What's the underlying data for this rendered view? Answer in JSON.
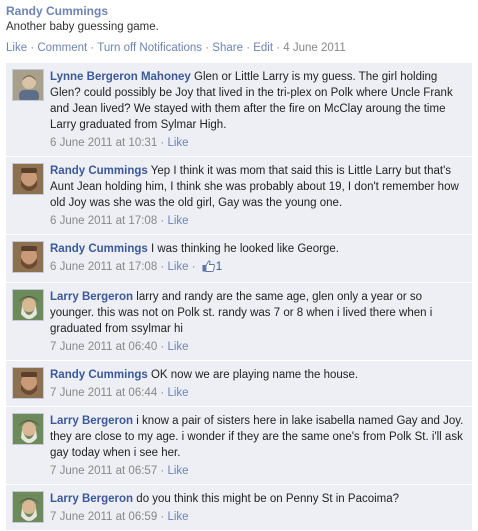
{
  "post": {
    "author": "Randy Cummings",
    "text": "Another baby guessing game.",
    "actions": [
      "Like",
      "Comment",
      "Turn off Notifications",
      "Share",
      "Edit"
    ],
    "date": "4 June 2011"
  },
  "comments": [
    {
      "author": "Lynne Bergeron Mahoney",
      "text": "Glen or Little Larry is my guess. The girl holding Glen? could possibly be Joy that lived in the tri-plex on Polk where Uncle Frank and Jean lived? We stayed with them after the fire on McClay aroung the time Larry graduated from Sylmar High.",
      "timestamp": "6 June 2011 at 10:31",
      "like": "Like"
    },
    {
      "author": "Randy Cummings",
      "text": "Yep I think it was mom that said this is Little Larry but that's Aunt Jean holding him, I think she was probably about 19, I don't remember how old Joy was she was the old girl, Gay was the young one.",
      "timestamp": "6 June 2011 at 17:08",
      "like": "Like"
    },
    {
      "author": "Randy Cummings",
      "text": "I was thinking he looked like George.",
      "timestamp": "6 June 2011 at 17:08",
      "like": "Like",
      "likes": "1"
    },
    {
      "author": "Larry Bergeron",
      "text": "larry and randy are the same age, glen only a year or so younger. this was not on Polk st. randy was 7 or 8 when i lived there when i graduated from ssylmar hi",
      "timestamp": "7 June 2011 at 06:40",
      "like": "Like"
    },
    {
      "author": "Randy Cummings",
      "text": "OK now we are playing name the house.",
      "timestamp": "7 June 2011 at 06:44",
      "like": "Like"
    },
    {
      "author": "Larry Bergeron",
      "text": "i know a pair of sisters here in lake isabella named Gay and Joy. they are close to my age. i wonder if they are the same one's from Polk St. i'll ask gay today when i see her.",
      "timestamp": "7 June 2011 at 06:57",
      "like": "Like"
    },
    {
      "author": "Larry Bergeron",
      "text": "do you think this might be on Penny St in Pacoima?",
      "timestamp": "7 June 2011 at 06:59",
      "like": "Like"
    }
  ]
}
